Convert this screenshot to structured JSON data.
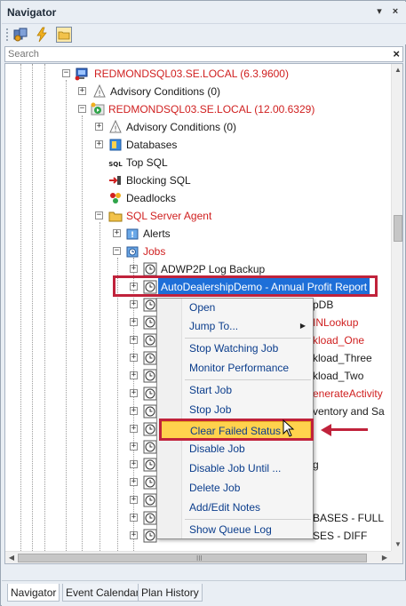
{
  "panel": {
    "title": "Navigator",
    "pin_glyph": "▾",
    "close_glyph": "×"
  },
  "search": {
    "placeholder": "Search",
    "clear_glyph": "×"
  },
  "tree": {
    "nodes": [
      {
        "label": "REDMONDSQL03.SE.LOCAL (6.3.9600)",
        "red": true,
        "icon": "server-icon",
        "expander": "−"
      },
      {
        "label": "Advisory Conditions (0)",
        "red": false,
        "icon": "advisory-icon",
        "expander": "+"
      },
      {
        "label": "REDMONDSQL03.SE.LOCAL (12.00.6329)",
        "red": true,
        "icon": "sql-instance-icon",
        "expander": "−"
      },
      {
        "label": "Advisory Conditions (0)",
        "red": false,
        "icon": "advisory-icon",
        "expander": "+"
      },
      {
        "label": "Databases",
        "red": false,
        "icon": "database-icon",
        "expander": "+"
      },
      {
        "label": "Top SQL",
        "red": false,
        "icon": "sql-icon",
        "expander": ""
      },
      {
        "label": "Blocking SQL",
        "red": false,
        "icon": "blocking-icon",
        "expander": ""
      },
      {
        "label": "Deadlocks",
        "red": false,
        "icon": "deadlock-icon",
        "expander": ""
      },
      {
        "label": "SQL Server Agent",
        "red": true,
        "icon": "folder-icon",
        "expander": "−"
      },
      {
        "label": "Alerts",
        "red": false,
        "icon": "alerts-icon",
        "expander": "+"
      },
      {
        "label": "Jobs",
        "red": true,
        "icon": "jobs-icon",
        "expander": "−"
      },
      {
        "label": "ADWP2P Log Backup",
        "red": false,
        "icon": "clock-icon",
        "expander": "+"
      },
      {
        "label": "AutoDealershipDemo - Annual Profit Report",
        "red": false,
        "icon": "clock-icon",
        "expander": "+",
        "selected": true
      },
      {
        "label": "pDB",
        "red": false,
        "icon": "clock-icon",
        "expander": "+"
      },
      {
        "label": "INLookup",
        "red": true,
        "icon": "clock-icon",
        "expander": "+"
      },
      {
        "label": "kload_One",
        "red": true,
        "icon": "clock-icon",
        "expander": "+"
      },
      {
        "label": "kload_Three",
        "red": false,
        "icon": "clock-icon",
        "expander": "+"
      },
      {
        "label": "kload_Two",
        "red": false,
        "icon": "clock-icon",
        "expander": "+"
      },
      {
        "label": "enerateActivity",
        "red": true,
        "icon": "clock-icon",
        "expander": "+"
      },
      {
        "label": "ventory and Sa",
        "red": false,
        "icon": "clock-icon",
        "expander": "+"
      },
      {
        "label": "",
        "red": false,
        "icon": "clock-icon",
        "expander": "+"
      },
      {
        "label": "",
        "red": false,
        "icon": "clock-icon",
        "expander": "+"
      },
      {
        "label": "g",
        "red": false,
        "icon": "clock-icon",
        "expander": "+"
      },
      {
        "label": "",
        "red": false,
        "icon": "clock-icon",
        "expander": "+"
      },
      {
        "label": "",
        "red": false,
        "icon": "clock-icon",
        "expander": "+"
      },
      {
        "label": "BASES - FULL",
        "red": false,
        "icon": "clock-icon",
        "expander": "+"
      },
      {
        "label": "SES - DIFF",
        "red": false,
        "icon": "clock-icon",
        "expander": "+"
      },
      {
        "label": "DatabaseBackup - USER_DATABASES - FULL",
        "red": false,
        "icon": "clock-icon",
        "expander": "+"
      }
    ]
  },
  "context_menu": {
    "items": [
      "Open",
      "Jump To...",
      "Stop Watching Job",
      "Monitor Performance",
      "Start Job",
      "Stop Job",
      "Clear Failed Status",
      "Disable Job",
      "Disable Job Until ...",
      "Delete Job",
      "Add/Edit Notes",
      "Show Queue Log"
    ],
    "highlighted": "Clear Failed Status",
    "submenu_glyph": "▶"
  },
  "scrollbars": {
    "up": "▲",
    "down": "▼",
    "left": "◀",
    "right": "▶",
    "grip": "III"
  },
  "tabs": [
    {
      "label": "Navigator",
      "active": true
    },
    {
      "label": "Event Calendar",
      "active": false
    },
    {
      "label": "Plan History",
      "active": false
    }
  ],
  "colors": {
    "accent_red": "#c0223b",
    "highlight": "#ffd24d",
    "selection": "#1e6fd8",
    "menu_text": "#0b3d8c"
  }
}
